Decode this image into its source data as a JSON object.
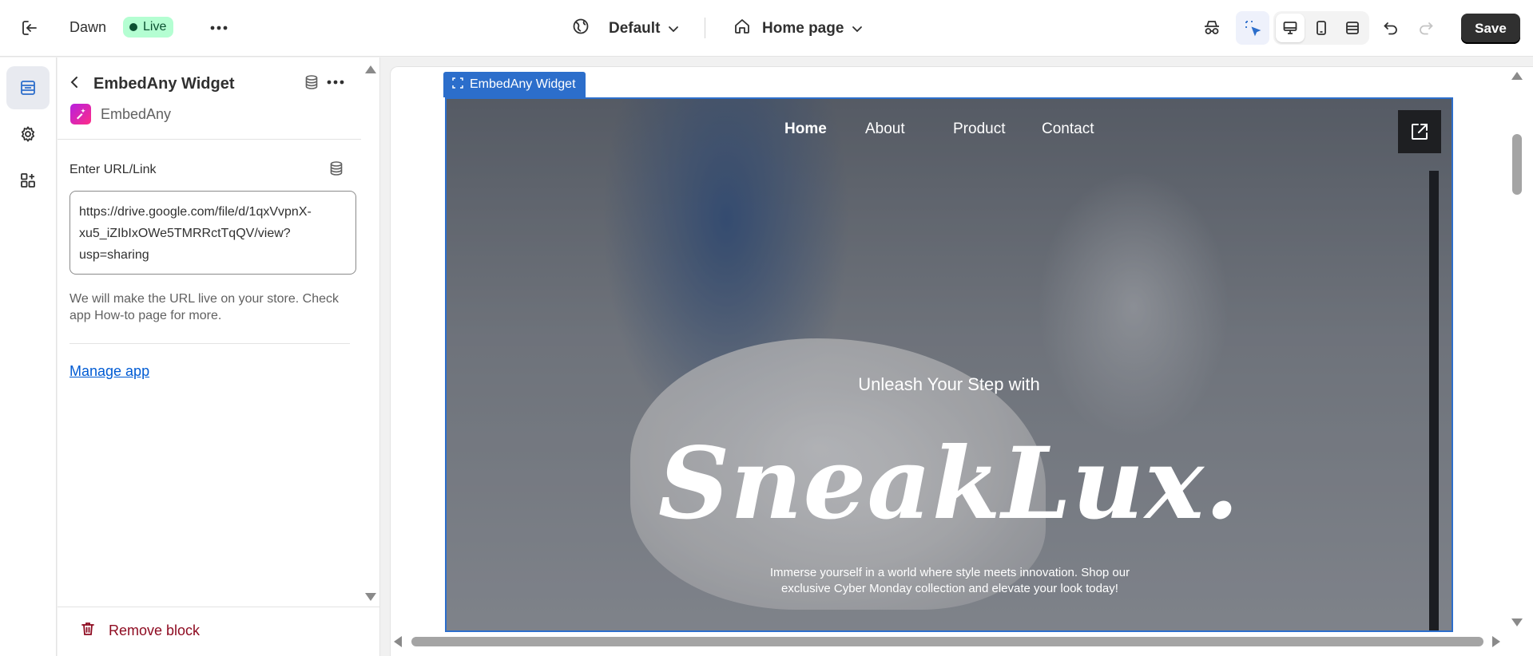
{
  "topbar": {
    "theme_name": "Dawn",
    "status_badge": "Live",
    "language_select": "Default",
    "page_select": "Home page",
    "save_label": "Save"
  },
  "panel": {
    "title": "EmbedAny Widget",
    "app_name": "EmbedAny",
    "field_label": "Enter URL/Link",
    "url_value": "https://drive.google.com/file/d/1qxVvpnX-\nxu5_iZIbIxOWe5TMRRctTqQV/view?\nusp=sharing",
    "help_text": "We will make the URL live on your store. Check app How-to page for more.",
    "manage_link": "Manage app",
    "remove_label": "Remove block"
  },
  "preview": {
    "widget_tag": "EmbedAny Widget",
    "nav": [
      "Home",
      "About",
      "Product",
      "Contact"
    ],
    "hero_subtitle": "Unleash Your Step with",
    "hero_title": "SneakLux.",
    "hero_description": "Immerse yourself in a world where style meets innovation. Shop our exclusive Cyber Monday collection and elevate your look today!"
  },
  "icons": {
    "exit": "exit-icon",
    "more": "more-horizontal-icon",
    "globe": "globe-icon",
    "home": "home-icon",
    "chevron": "chevron-down-icon",
    "inspector": "incognito-icon",
    "select": "select-element-icon",
    "desktop": "desktop-icon",
    "mobile": "mobile-icon",
    "fullwidth": "fullwidth-icon",
    "undo": "undo-icon",
    "redo": "redo-icon",
    "sections": "sections-icon",
    "settings": "gear-icon",
    "apps": "apps-icon",
    "back": "chevron-left-icon",
    "database": "database-icon",
    "trash": "trash-icon",
    "external": "external-link-icon"
  },
  "colors": {
    "accent": "#2c6ecb",
    "live_badge": "#b4fed2",
    "save_button": "#303030",
    "link": "#005bd3",
    "danger": "#8e0b21"
  }
}
